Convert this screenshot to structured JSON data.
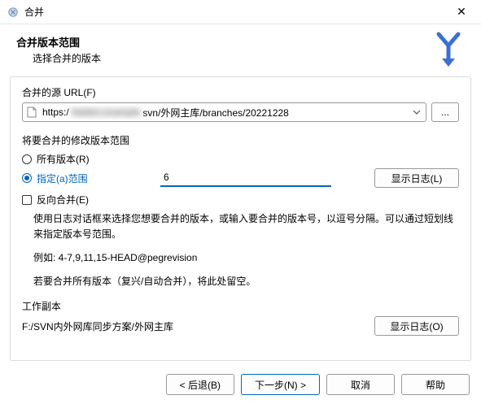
{
  "window": {
    "title": "合并"
  },
  "header": {
    "title": "合并版本范围",
    "subtitle": "选择合并的版本"
  },
  "source": {
    "label": "合并的源 URL(F)",
    "prefix": "https:/",
    "hidden": "hidden.example",
    "suffix": "svn/外网主库/branches/20221228",
    "browse": "..."
  },
  "range": {
    "group_label": "将要合并的修改版本范围",
    "opt_all": "所有版本(R)",
    "opt_specific": "指定(a)范围",
    "input_value": "6",
    "show_log_l": "显示日志(L)",
    "opt_reverse": "反向合并(E)",
    "help1": "使用日志对话框来选择您想要合并的版本，或输入要合并的版本号，以逗号分隔。可以通过短划线来指定版本号范围。",
    "example": "例如: 4-7,9,11,15-HEAD@pegrevision",
    "help2": "若要合并所有版本（复兴/自动合并），将此处留空。"
  },
  "wc": {
    "label": "工作副本",
    "path": "F:/SVN内外网库同步方案/外网主库",
    "show_log_o": "显示日志(O)"
  },
  "footer": {
    "back": "< 后退(B)",
    "next": "下一步(N) >",
    "cancel": "取消",
    "help": "帮助"
  }
}
